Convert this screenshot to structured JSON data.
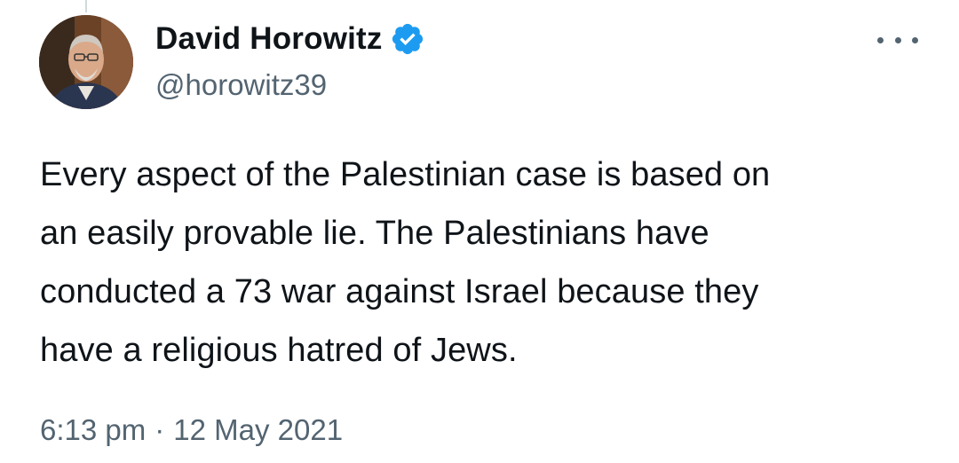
{
  "author": {
    "display_name": "David Horowitz",
    "handle": "@horowitz39",
    "verified": true,
    "verified_color": "#1d9bf0"
  },
  "tweet": {
    "text": "Every aspect of the Palestinian case is based on\nan easily provable lie. The Palestinians have\nconducted a 73 war against Israel because they\nhave a religious hatred of Jews.",
    "time": "6:13 pm",
    "separator": "·",
    "date": "12 May 2021"
  },
  "icons": {
    "more": "more-horizontal-icon",
    "verified": "verified-badge-icon"
  },
  "colors": {
    "text_primary": "#0f1419",
    "text_secondary": "#536471"
  }
}
